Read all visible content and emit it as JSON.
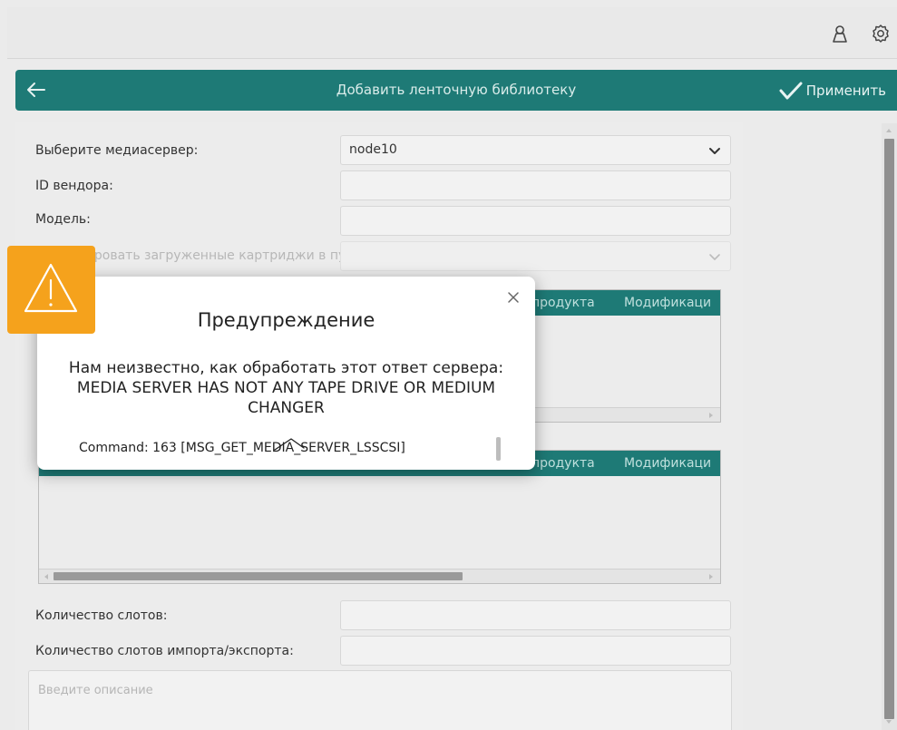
{
  "header": {
    "title": "Добавить ленточную библиотеку",
    "apply_label": "Применить"
  },
  "form": {
    "mediaserver_label": "Выберите медиасервер:",
    "mediaserver_value": "node10",
    "vendor_label": "ID вендора:",
    "model_label": "Модель:",
    "pool_label": "Импортировать загруженные картриджи в пул:",
    "slots_label": "Количество слотов:",
    "ie_slots_label": "Количество слотов импорта/экспорта:",
    "description_placeholder": "Введите описание"
  },
  "tables": {
    "drives": {
      "visible_columns": [
        "продукта",
        "Модификаци"
      ]
    },
    "changers": {
      "visible_columns": [
        "продукта",
        "Модификаци"
      ]
    }
  },
  "dialog": {
    "title": "Предупреждение",
    "message": "Нам неизвестно, как обработать этот ответ сервера:  MEDIA SERVER HAS NOT ANY TAPE DRIVE OR MEDIUM CHANGER",
    "command": "Command: 163 [MSG_GET_MEDIA_SERVER_LSSCSI]"
  },
  "icons": {
    "user": "user-icon",
    "settings": "gear-icon",
    "back": "back-arrow-icon",
    "apply": "checkmark-icon",
    "close": "close-icon",
    "warning": "warning-icon",
    "dropdown": "chevron-down-icon"
  },
  "colors": {
    "accent": "#1e7a76",
    "warning": "#f5a21c",
    "background": "#ebebeb"
  }
}
